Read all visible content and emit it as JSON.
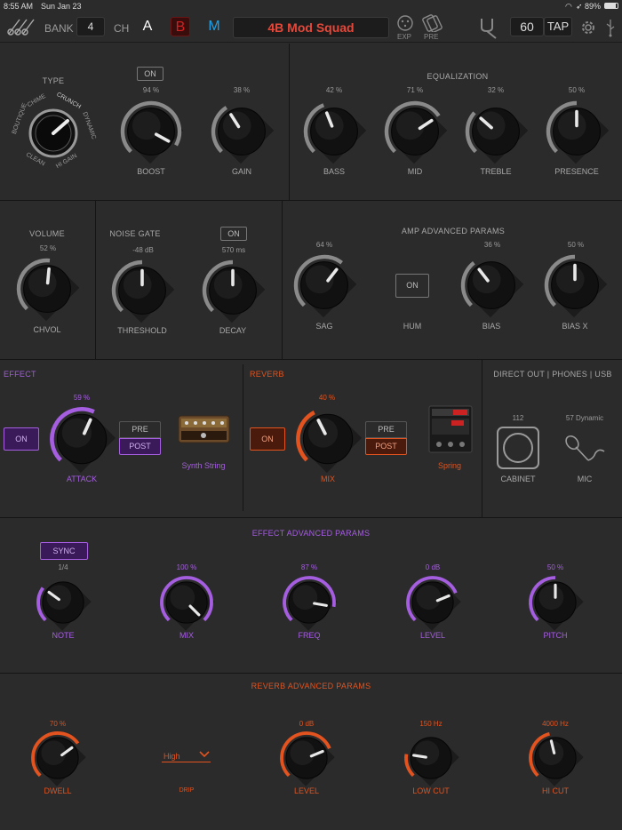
{
  "status": {
    "time": "8:55 AM",
    "date": "Sun Jan 23",
    "battery": "89%"
  },
  "topbar": {
    "bank_label": "BANK",
    "bank_value": "4",
    "ch_label": "CH",
    "ch_a": "A",
    "ch_b": "B",
    "ch_m": "M",
    "preset_name": "4B Mod Squad",
    "exp_label": "EXP",
    "pre_label": "PRE",
    "tempo": "60",
    "tap_label": "TAP",
    "icons": [
      "guitar-icon",
      "exp-pedal-icon",
      "pre-icon",
      "tuner-fork-icon",
      "gear-icon",
      "usb-icon"
    ]
  },
  "amp": {
    "type_label": "TYPE",
    "type_options": [
      "BOUTIQUE",
      "CHIME",
      "CRUNCH",
      "DYNAMIC",
      "HI GAIN",
      "CLEAN"
    ],
    "boost_on": "ON",
    "boost": {
      "label": "BOOST",
      "pct": "94 %",
      "value": 0.94
    },
    "gain": {
      "label": "GAIN",
      "pct": "38 %",
      "value": 0.38
    }
  },
  "eq": {
    "title": "EQUALIZATION",
    "knobs": [
      {
        "label": "BASS",
        "pct": "42 %",
        "value": 0.42
      },
      {
        "label": "MID",
        "pct": "71 %",
        "value": 0.71
      },
      {
        "label": "TREBLE",
        "pct": "32 %",
        "value": 0.32
      },
      {
        "label": "PRESENCE",
        "pct": "50 %",
        "value": 0.5
      }
    ]
  },
  "volume": {
    "title": "VOLUME",
    "pct": "52 %",
    "label": "CHVOL",
    "value": 0.52
  },
  "noise_gate": {
    "title": "NOISE GATE",
    "on": "ON",
    "threshold": {
      "label": "THRESHOLD",
      "pct": "-48 dB",
      "value": 0.5
    },
    "decay": {
      "label": "DECAY",
      "pct": "570 ms",
      "value": 0.5
    }
  },
  "amp_adv": {
    "title": "AMP ADVANCED PARAMS",
    "sag": {
      "label": "SAG",
      "pct": "64 %",
      "value": 0.64
    },
    "hum": {
      "label": "HUM",
      "on": "ON"
    },
    "bias": {
      "label": "BIAS",
      "pct": "36 %",
      "value": 0.36
    },
    "bias_x": {
      "label": "BIAS X",
      "pct": "50 %",
      "value": 0.5
    }
  },
  "effect": {
    "title": "EFFECT",
    "on": "ON",
    "pre": "PRE",
    "post": "POST",
    "attack": {
      "label": "ATTACK",
      "pct": "59 %",
      "value": 0.59
    },
    "model": "Synth String"
  },
  "reverb": {
    "title": "REVERB",
    "on": "ON",
    "pre": "PRE",
    "post": "POST",
    "mix": {
      "label": "MIX",
      "pct": "40 %",
      "value": 0.4
    },
    "model": "Spring"
  },
  "direct": {
    "title": "DIRECT OUT | PHONES | USB",
    "cab_value": "112",
    "cab_label": "CABINET",
    "mic_value": "57 Dynamic",
    "mic_label": "MIC"
  },
  "effect_adv": {
    "title": "EFFECT ADVANCED PARAMS",
    "sync": "SYNC",
    "knobs": [
      {
        "label": "NOTE",
        "pct": "1/4",
        "value": 0.3
      },
      {
        "label": "MIX",
        "pct": "100 %",
        "value": 1.0
      },
      {
        "label": "FREQ",
        "pct": "87 %",
        "value": 0.87
      },
      {
        "label": "LEVEL",
        "pct": "0 dB",
        "value": 0.75
      },
      {
        "label": "PITCH",
        "pct": "50 %",
        "value": 0.5
      }
    ]
  },
  "reverb_adv": {
    "title": "REVERB ADVANCED PARAMS",
    "dwell": {
      "label": "DWELL",
      "pct": "70 %",
      "value": 0.7
    },
    "drip": {
      "label": "DRIP",
      "value": "High"
    },
    "level": {
      "label": "LEVEL",
      "pct": "0 dB",
      "value": 0.75
    },
    "low_cut": {
      "label": "LOW CUT",
      "pct": "150 Hz",
      "value": 0.2
    },
    "hi_cut": {
      "label": "HI CUT",
      "pct": "4000 Hz",
      "value": 0.45
    }
  },
  "colors": {
    "gray_arc": "#8a8a8a",
    "purple": "#a55ee0",
    "orange": "#e2531f",
    "red": "#d42020",
    "blue": "#1fa0e6",
    "orange_text": "#e2531f"
  }
}
